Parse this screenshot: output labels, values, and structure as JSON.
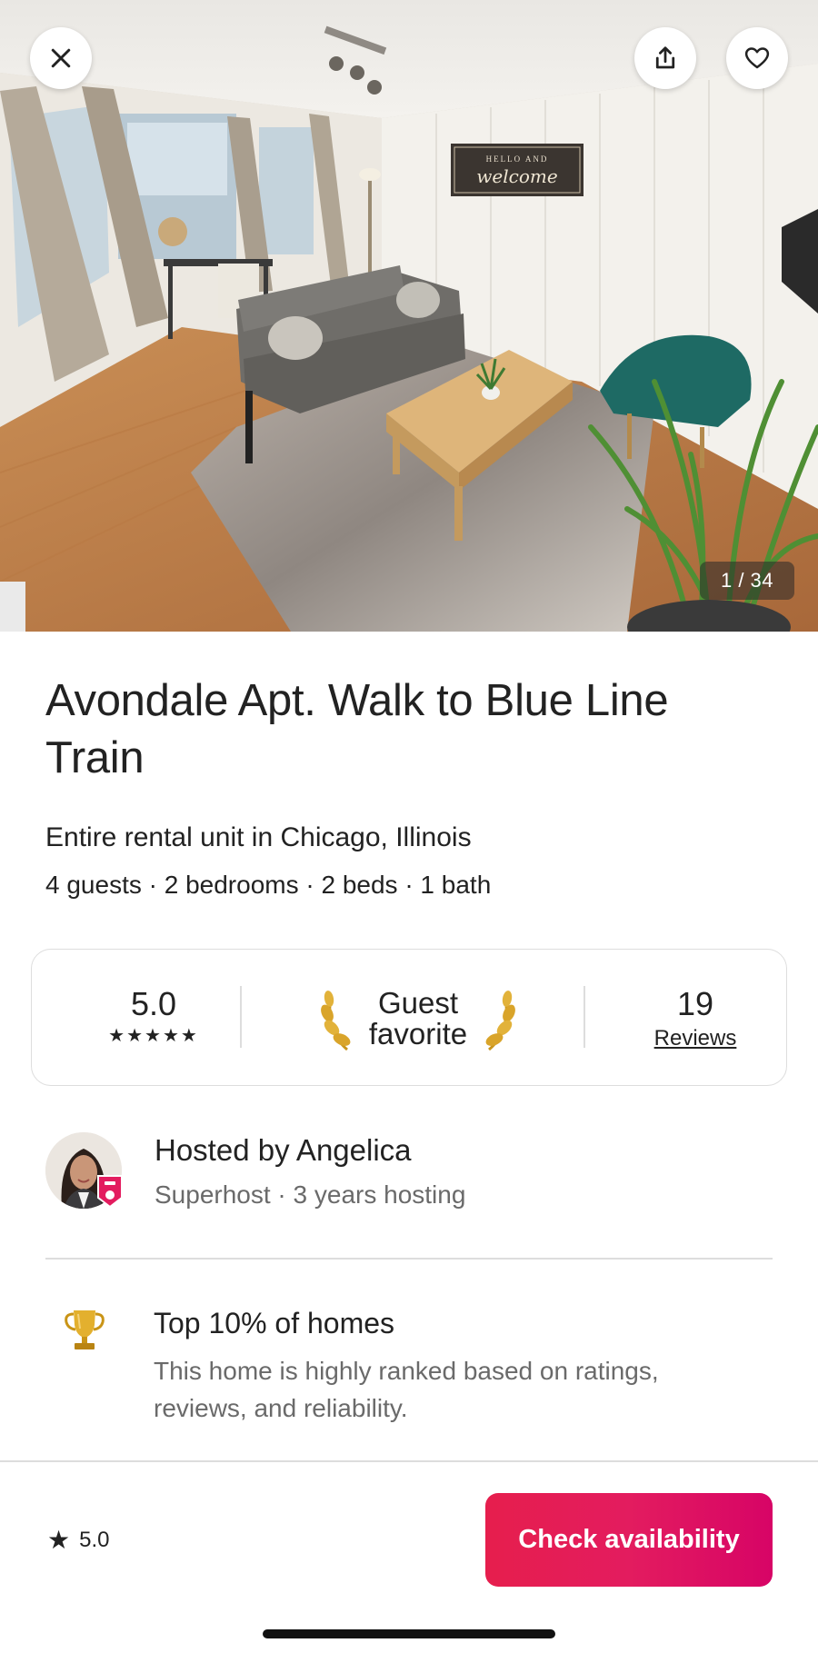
{
  "hero": {
    "photo_counter": "1 / 34",
    "sign_line1": "HELLO AND",
    "sign_line2": "welcome",
    "icons": {
      "close": "close-icon",
      "share": "share-icon",
      "favorite": "heart-icon"
    }
  },
  "listing": {
    "title": "Avondale Apt. Walk to Blue Line Train",
    "subtitle": "Entire rental unit in Chicago, Illinois",
    "details": "4 guests · 2 bedrooms · 2 beds · 1 bath"
  },
  "rating_card": {
    "score": "5.0",
    "stars": "★★★★★",
    "guest_favorite_line1": "Guest",
    "guest_favorite_line2": "favorite",
    "reviews_count": "19",
    "reviews_label": "Reviews"
  },
  "host": {
    "name": "Hosted by Angelica",
    "sub": "Superhost · 3 years hosting"
  },
  "highlight": {
    "title": "Top 10% of homes",
    "description": "This home is highly ranked based on ratings, reviews, and reliability."
  },
  "bottom_bar": {
    "rating": "5.0",
    "cta_label": "Check availability"
  },
  "colors": {
    "brand": "#E31C5F",
    "text": "#222222",
    "muted": "#6A6A6A",
    "divider": "#DDDDDD",
    "gold": "#D4A017"
  }
}
